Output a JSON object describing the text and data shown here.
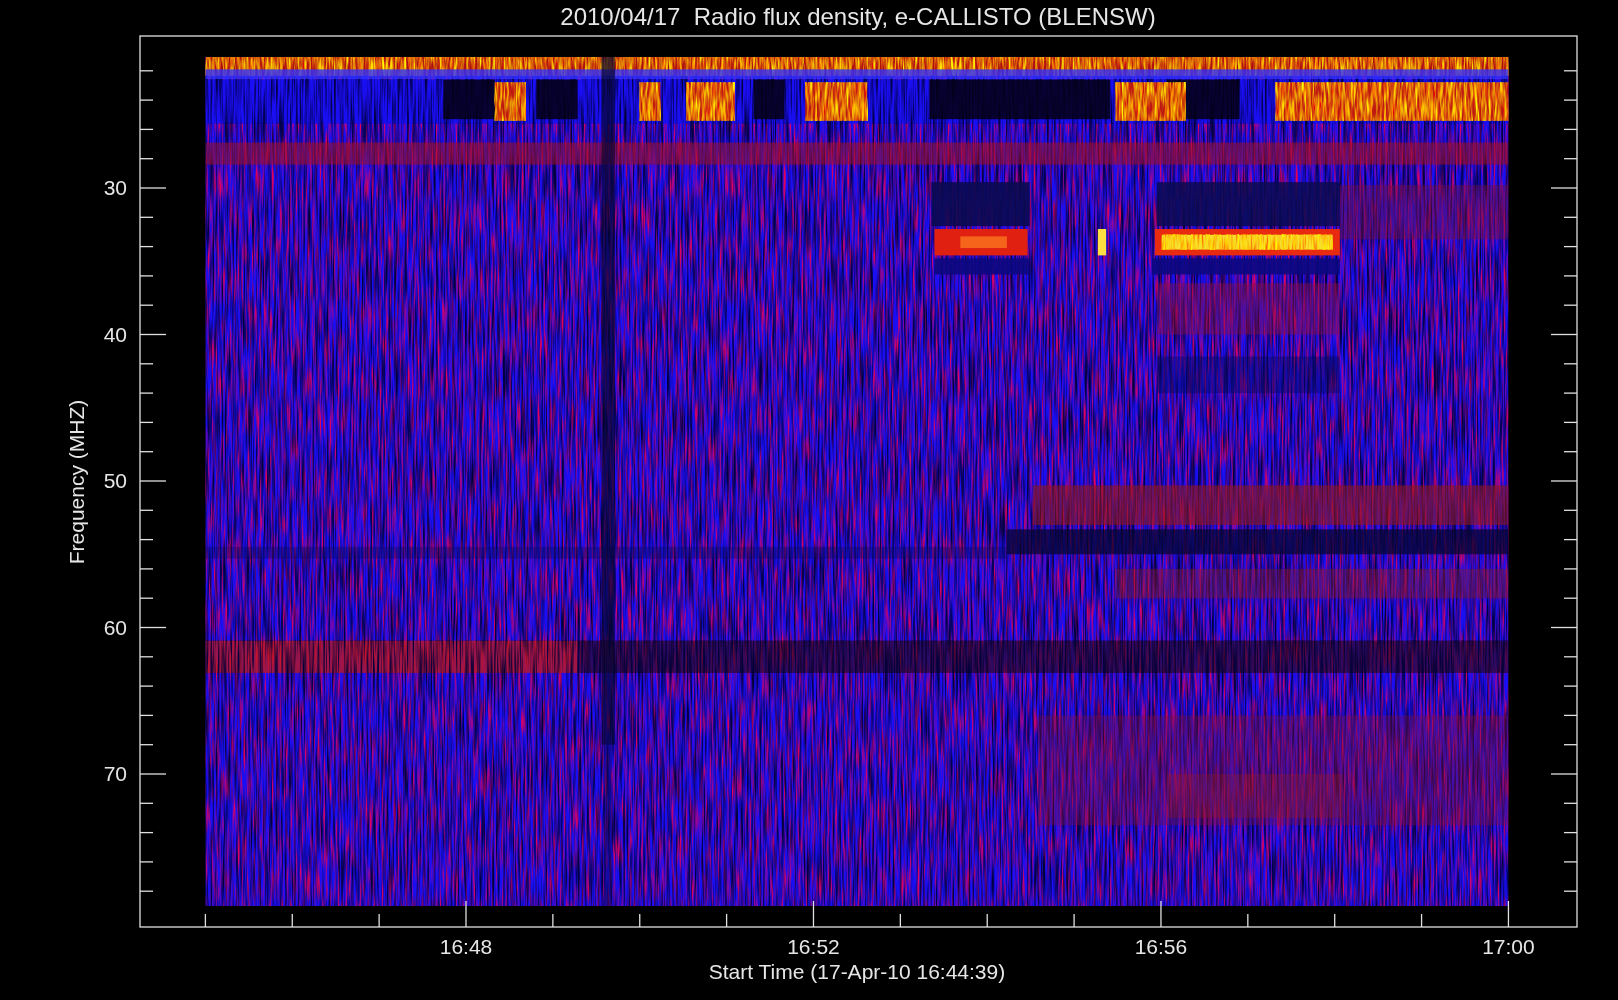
{
  "chart": {
    "title": "2010/04/17  Radio flux density, e-CALLISTO (BLENSW)",
    "ylabel": "Frequency (MHZ)",
    "xlabel": "Start Time (17-Apr-10 16:44:39)",
    "xticks": [
      "16:48",
      "16:52",
      "16:56",
      "17:00"
    ],
    "yticks": [
      "30",
      "40",
      "50",
      "60",
      "70"
    ]
  }
}
